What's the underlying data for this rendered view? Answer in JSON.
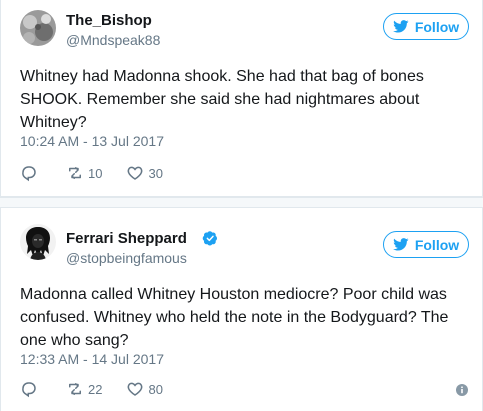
{
  "tweets": [
    {
      "display_name": "The_Bishop",
      "handle": "@Mndspeak88",
      "follow_label": "Follow",
      "text": "Whitney had Madonna shook. She had that bag of bones SHOOK. Remember she said she had nightmares about Whitney?",
      "timestamp": "10:24 AM - 13 Jul 2017",
      "replies": "",
      "retweets": "10",
      "likes": "30",
      "avatar_icon": "grey-textured-avatar"
    },
    {
      "display_name": "Ferrari Sheppard",
      "handle": "@stopbeingfamous",
      "verified": true,
      "follow_label": "Follow",
      "text": "Madonna called Whitney Houston mediocre? Poor child was confused. Whitney who held the note in the Bodyguard? The one who sang?",
      "timestamp": "12:33 AM - 14 Jul 2017",
      "replies": "",
      "retweets": "22",
      "likes": "80",
      "avatar_icon": "dreadlocks-portrait-avatar"
    }
  ],
  "colors": {
    "accent": "#1da1f2",
    "muted": "#657786",
    "text": "#14171a",
    "border": "#e1e8ed",
    "separator": "#f5f8fa"
  },
  "icons": {
    "reply": "reply-icon",
    "retweet": "retweet-icon",
    "like": "heart-icon",
    "verified": "verified-badge-icon",
    "twitter_bird": "twitter-bird-icon",
    "info": "info-icon"
  }
}
